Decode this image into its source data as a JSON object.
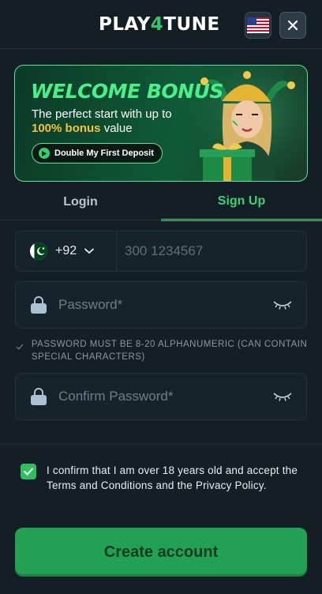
{
  "header": {
    "logo_part1": "PLAY",
    "logo_four": "4",
    "logo_part2": "TUNE",
    "flag_icon": "us-flag-icon",
    "close_icon": "close-icon"
  },
  "banner": {
    "title": "WELCOME BONUS",
    "line1": "The perfect start with up to",
    "highlight": "100% bonus",
    "line2_rest": " value",
    "button_label": "Double My First Deposit"
  },
  "tabs": [
    {
      "label": "Login",
      "active": false
    },
    {
      "label": "Sign Up",
      "active": true
    }
  ],
  "phone": {
    "country_flag": "pakistan-flag-icon",
    "dial_code": "+92",
    "placeholder": "300 1234567"
  },
  "password": {
    "placeholder": "Password*",
    "hint": "PASSWORD MUST BE 8-20 ALPHANUMERIC (CAN CONTAIN SPECIAL CHARACTERS)"
  },
  "confirm_password": {
    "placeholder": "Confirm Password*"
  },
  "consent": {
    "checked": true,
    "text": "I confirm that I am over 18 years old and accept the Terms and Conditions and the Privacy Policy."
  },
  "submit": {
    "label": "Create account"
  },
  "colors": {
    "background": "#141e25",
    "accent": "#3ad07a",
    "button": "#22a154",
    "highlight": "#f4c23a"
  }
}
